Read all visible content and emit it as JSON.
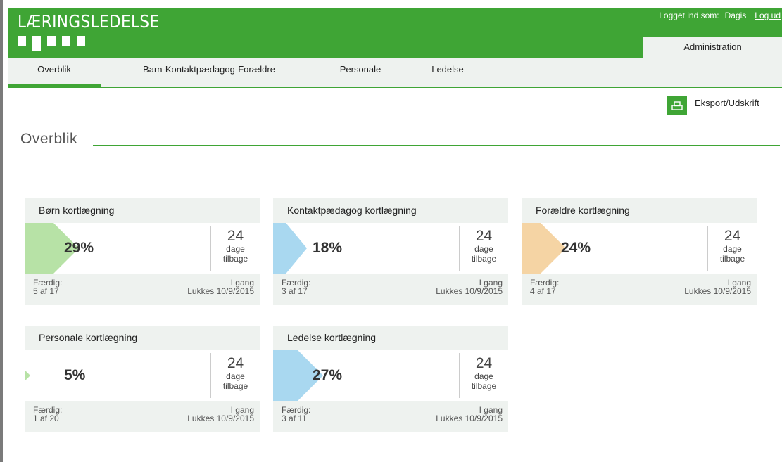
{
  "header": {
    "logo_text": "LÆRINGSLEDELSE",
    "logged_in_label": "Logget ind som:",
    "user_name": "Dagis",
    "logout_label": "Log ud",
    "admin_label": "Administration",
    "brand_color": "#3fa535"
  },
  "nav": {
    "items": [
      {
        "label": "Overblik"
      },
      {
        "label": "Barn-Kontaktpædagog-Forældre"
      },
      {
        "label": "Personale"
      },
      {
        "label": "Ledelse"
      }
    ]
  },
  "toolbar": {
    "export_label": "Eksport/Udskrift",
    "export_icon": "printer-icon"
  },
  "page": {
    "title": "Overblik"
  },
  "cards": [
    {
      "title": "Børn kortlægning",
      "percent": "29%",
      "progress": 0.29,
      "color": "#b7e2a6",
      "days": "24",
      "days_line1": "dage",
      "days_line2": "tilbage",
      "done_label": "Færdig:",
      "done_value": "5 af 17",
      "status": "I gang",
      "closes": "Lukkes 10/9/2015"
    },
    {
      "title": "Kontaktpædagog kortlægning",
      "percent": "18%",
      "progress": 0.18,
      "color": "#a9d8f0",
      "days": "24",
      "days_line1": "dage",
      "days_line2": "tilbage",
      "done_label": "Færdig:",
      "done_value": "3 af 17",
      "status": "I gang",
      "closes": "Lukkes 10/9/2015"
    },
    {
      "title": "Forældre kortlægning",
      "percent": "24%",
      "progress": 0.24,
      "color": "#f5d4a4",
      "days": "24",
      "days_line1": "dage",
      "days_line2": "tilbage",
      "done_label": "Færdig:",
      "done_value": "4 af 17",
      "status": "I gang",
      "closes": "Lukkes 10/9/2015"
    },
    {
      "title": "Personale kortlægning",
      "percent": "5%",
      "progress": 0.05,
      "color": "#b7e2a6",
      "days": "24",
      "days_line1": "dage",
      "days_line2": "tilbage",
      "done_label": "Færdig:",
      "done_value": "1 af 20",
      "status": "I gang",
      "closes": "Lukkes 10/9/2015"
    },
    {
      "title": "Ledelse kortlægning",
      "percent": "27%",
      "progress": 0.27,
      "color": "#a9d8f0",
      "days": "24",
      "days_line1": "dage",
      "days_line2": "tilbage",
      "done_label": "Færdig:",
      "done_value": "3 af 11",
      "status": "I gang",
      "closes": "Lukkes 10/9/2015"
    }
  ]
}
